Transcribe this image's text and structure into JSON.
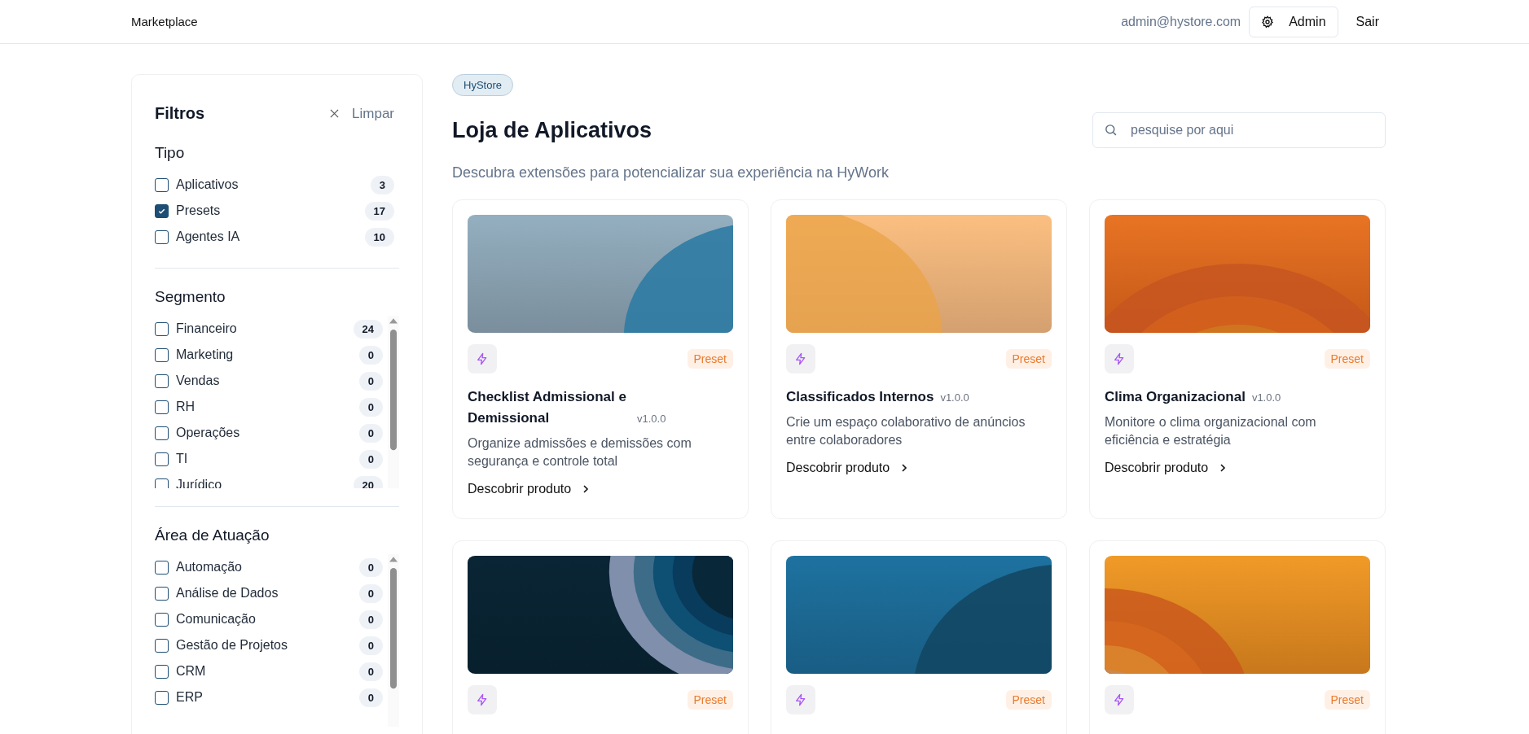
{
  "header": {
    "brand": "Marketplace",
    "user_email": "admin@hystore.com",
    "admin_button": "Admin",
    "logout": "Sair"
  },
  "filters": {
    "title": "Filtros",
    "clear": "Limpar",
    "groups": [
      {
        "title": "Tipo",
        "items": [
          {
            "label": "Aplicativos",
            "count": "3",
            "checked": false
          },
          {
            "label": "Presets",
            "count": "17",
            "checked": true
          },
          {
            "label": "Agentes IA",
            "count": "10",
            "checked": false
          }
        ]
      },
      {
        "title": "Segmento",
        "items": [
          {
            "label": "Financeiro",
            "count": "24",
            "checked": false
          },
          {
            "label": "Marketing",
            "count": "0",
            "checked": false
          },
          {
            "label": "Vendas",
            "count": "0",
            "checked": false
          },
          {
            "label": "RH",
            "count": "0",
            "checked": false
          },
          {
            "label": "Operações",
            "count": "0",
            "checked": false
          },
          {
            "label": "TI",
            "count": "0",
            "checked": false
          },
          {
            "label": "Jurídico",
            "count": "20",
            "checked": false
          }
        ]
      },
      {
        "title": "Área de Atuação",
        "items": [
          {
            "label": "Automação",
            "count": "0",
            "checked": false
          },
          {
            "label": "Análise de Dados",
            "count": "0",
            "checked": false
          },
          {
            "label": "Comunicação",
            "count": "0",
            "checked": false
          },
          {
            "label": "Gestão de Projetos",
            "count": "0",
            "checked": false
          },
          {
            "label": "CRM",
            "count": "0",
            "checked": false
          },
          {
            "label": "ERP",
            "count": "0",
            "checked": false
          }
        ]
      }
    ]
  },
  "store": {
    "badge": "HyStore",
    "title": "Loja de Aplicativos",
    "subtitle": "Descubra extensões para potencializar sua experiência na HyWork",
    "search": {
      "placeholder": "pesquise por aqui"
    }
  },
  "products": [
    {
      "title": "Checklist Admissional e Demissional",
      "version": "v1.0.0",
      "tag": "Preset",
      "description": "Organize admissões e demissões com segurança e controle total",
      "link": "Descobrir produto"
    },
    {
      "title": "Classificados Internos",
      "version": "v1.0.0",
      "tag": "Preset",
      "description": "Crie um espaço colaborativo de anúncios entre colaboradores",
      "link": "Descobrir produto"
    },
    {
      "title": "Clima Organizacional",
      "version": "v1.0.0",
      "tag": "Preset",
      "description": "Monitore o clima organizacional com eficiência e estratégia",
      "link": "Descobrir produto"
    },
    {
      "tag": "Preset"
    },
    {
      "tag": "Preset"
    },
    {
      "tag": "Preset"
    }
  ]
}
